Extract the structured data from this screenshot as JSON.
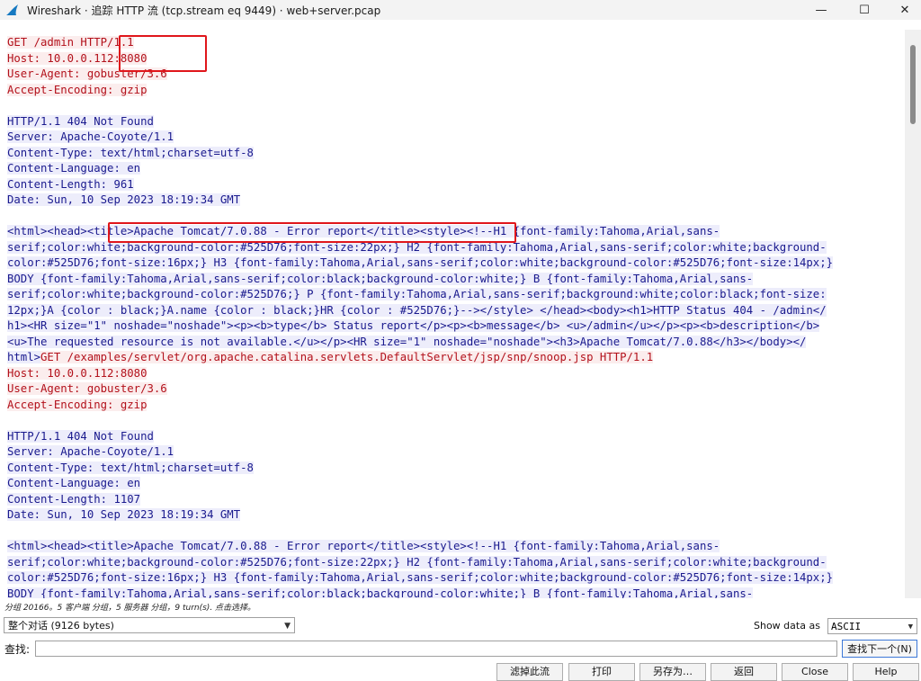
{
  "window": {
    "title": "Wireshark · 追踪 HTTP 流 (tcp.stream eq 9449) · web+server.pcap",
    "minimize": "—",
    "maximize": "☐",
    "close": "✕"
  },
  "stream_lines": [
    {
      "t": "GET /admin HTTP/1.1",
      "k": "cl"
    },
    {
      "t": "Host: 10.0.0.112:8080",
      "k": "cl"
    },
    {
      "t": "User-Agent: gobuster/3.6",
      "k": "cl"
    },
    {
      "t": "Accept-Encoding: gzip",
      "k": "cl"
    },
    {
      "t": "",
      "k": "bl"
    },
    {
      "t": "HTTP/1.1 404 Not Found",
      "k": "sv"
    },
    {
      "t": "Server: Apache-Coyote/1.1",
      "k": "sv"
    },
    {
      "t": "Content-Type: text/html;charset=utf-8",
      "k": "sv"
    },
    {
      "t": "Content-Language: en",
      "k": "sv"
    },
    {
      "t": "Content-Length: 961",
      "k": "sv"
    },
    {
      "t": "Date: Sun, 10 Sep 2023 18:19:34 GMT",
      "k": "sv"
    },
    {
      "t": "",
      "k": "bl"
    },
    {
      "t": "<html><head><title>Apache Tomcat/7.0.88 - Error report</title><style><!--H1 {font-family:Tahoma,Arial,sans-",
      "k": "sv"
    },
    {
      "t": "serif;color:white;background-color:#525D76;font-size:22px;} H2 {font-family:Tahoma,Arial,sans-serif;color:white;background-",
      "k": "sv"
    },
    {
      "t": "color:#525D76;font-size:16px;} H3 {font-family:Tahoma,Arial,sans-serif;color:white;background-color:#525D76;font-size:14px;}",
      "k": "sv"
    },
    {
      "t": "BODY {font-family:Tahoma,Arial,sans-serif;color:black;background-color:white;} B {font-family:Tahoma,Arial,sans-",
      "k": "sv"
    },
    {
      "t": "serif;color:white;background-color:#525D76;} P {font-family:Tahoma,Arial,sans-serif;background:white;color:black;font-size:",
      "k": "sv"
    },
    {
      "t": "12px;}A {color : black;}A.name {color : black;}HR {color : #525D76;}--></style> </head><body><h1>HTTP Status 404 - /admin</",
      "k": "sv"
    },
    {
      "t": "h1><HR size=\"1\" noshade=\"noshade\"><p><b>type</b> Status report</p><p><b>message</b> <u>/admin</u></p><p><b>description</b>",
      "k": "sv"
    },
    {
      "t": "<u>The requested resource is not available.</u></p><HR size=\"1\" noshade=\"noshade\"><h3>Apache Tomcat/7.0.88</h3></body></",
      "k": "sv"
    },
    {
      "t": "html>",
      "k": "sv",
      "tail": "GET /examples/servlet/org.apache.catalina.servlets.DefaultServlet/jsp/snp/snoop.jsp HTTP/1.1",
      "tk": "cl"
    },
    {
      "t": "Host: 10.0.0.112:8080",
      "k": "cl"
    },
    {
      "t": "User-Agent: gobuster/3.6",
      "k": "cl"
    },
    {
      "t": "Accept-Encoding: gzip",
      "k": "cl"
    },
    {
      "t": "",
      "k": "bl"
    },
    {
      "t": "HTTP/1.1 404 Not Found",
      "k": "sv"
    },
    {
      "t": "Server: Apache-Coyote/1.1",
      "k": "sv"
    },
    {
      "t": "Content-Type: text/html;charset=utf-8",
      "k": "sv"
    },
    {
      "t": "Content-Language: en",
      "k": "sv"
    },
    {
      "t": "Content-Length: 1107",
      "k": "sv"
    },
    {
      "t": "Date: Sun, 10 Sep 2023 18:19:34 GMT",
      "k": "sv"
    },
    {
      "t": "",
      "k": "bl"
    },
    {
      "t": "<html><head><title>Apache Tomcat/7.0.88 - Error report</title><style><!--H1 {font-family:Tahoma,Arial,sans-",
      "k": "sv"
    },
    {
      "t": "serif;color:white;background-color:#525D76;font-size:22px;} H2 {font-family:Tahoma,Arial,sans-serif;color:white;background-",
      "k": "sv"
    },
    {
      "t": "color:#525D76;font-size:16px;} H3 {font-family:Tahoma,Arial,sans-serif;color:white;background-color:#525D76;font-size:14px;}",
      "k": "sv"
    },
    {
      "t": "BODY {font-family:Tahoma,Arial,sans-serif;color:black;background-color:white;} B {font-family:Tahoma,Arial,sans-",
      "k": "sv"
    }
  ],
  "status_text": "分组 20166。5 客户端 分组，5 服务器 分组，9 turn(s). 点击选择。",
  "controls": {
    "conversation": "整个对话 (9126 bytes)",
    "show_data_as_label": "Show data as",
    "format": "ASCII",
    "find_label": "查找:",
    "find_value": "",
    "find_next": "查找下一个(N)"
  },
  "bottom_buttons": [
    "滤掉此流",
    "打印",
    "另存为…",
    "返回",
    "Close",
    "Help"
  ],
  "colors": {
    "client_text": "#b3111b",
    "client_bg": "#fbeded",
    "server_text": "#1a1a8e",
    "server_bg": "#ededfb",
    "highlight": "#e0161b"
  }
}
